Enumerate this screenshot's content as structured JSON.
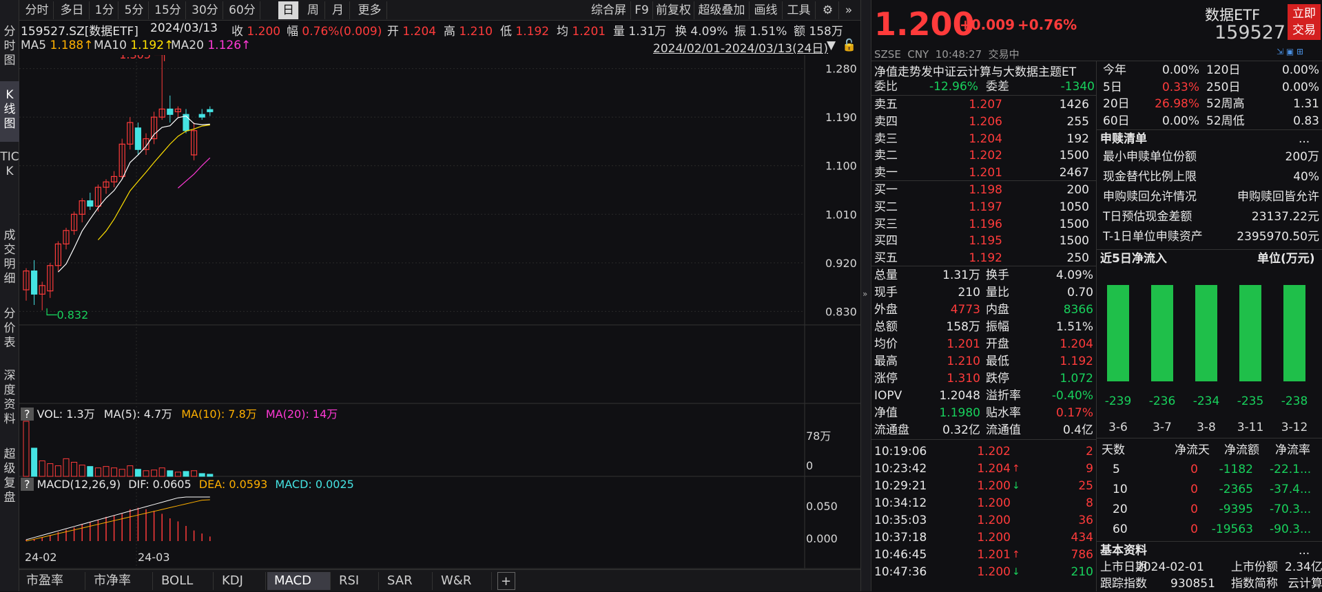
{
  "left_tabs": [
    "分时图",
    "K线图",
    "TICK",
    "成交明细",
    "分价表",
    "深度资料",
    "超级复盘"
  ],
  "toolbar": {
    "periods": [
      "分时",
      "多日",
      "1分",
      "5分",
      "15分",
      "30分",
      "60分",
      "日",
      "周",
      "月",
      "更多"
    ],
    "active": "日",
    "tools": [
      "综合屏",
      "F9",
      "前复权",
      "超级叠加",
      "画线",
      "工具"
    ]
  },
  "info": {
    "code": "159527.SZ[数据ETF]",
    "date": "2024/03/13",
    "close_label": "收",
    "close": "1.200",
    "chg_label": "幅",
    "chg": "0.76%(0.009)",
    "open_label": "开",
    "open": "1.204",
    "high_label": "高",
    "high": "1.210",
    "low_label": "低",
    "low": "1.192",
    "avg_label": "均",
    "avg": "1.201",
    "vol_label": "量",
    "vol": "1.31万",
    "turn_label": "换",
    "turn": "4.09%",
    "amp_label": "振",
    "amp": "1.51%",
    "amt_label": "额",
    "amt": "158万"
  },
  "ma": {
    "ma5_label": "MA5",
    "ma5": "1.188↑",
    "ma10_label": "MA10",
    "ma10": "1.192↑",
    "ma20_label": "MA20",
    "ma20": "1.126↑",
    "range": "2024/02/01-2024/03/13(24日)"
  },
  "price_axis": [
    "1.280",
    "1.190",
    "1.100",
    "1.010",
    "0.920",
    "0.830"
  ],
  "max_label": "1.305",
  "min_label": "0.832",
  "vol_panel": {
    "q": "?",
    "label": "VOL: 1.3万",
    "ma5": "MA(5): 4.7万",
    "ma10": "MA(10): 7.8万",
    "ma20": "MA(20): 14万",
    "axis": [
      "78万",
      "0"
    ]
  },
  "macd_panel": {
    "q": "?",
    "label": "MACD(12,26,9)",
    "dif": "DIF: 0.0605",
    "dea": "DEA: 0.0593",
    "macd": "MACD: 0.0025",
    "axis": [
      "0.050",
      "0.000"
    ]
  },
  "x_axis": [
    "24-02",
    "24-03"
  ],
  "bottom_tabs": [
    "市盈率",
    "市净率",
    "BOLL",
    "KDJ",
    "MACD",
    "RSI",
    "SAR",
    "W&R"
  ],
  "bottom_active": "MACD",
  "chart_data": {
    "type": "candlestick",
    "days": [
      {
        "o": 0.87,
        "h": 0.91,
        "l": 0.85,
        "c": 0.905,
        "up": true
      },
      {
        "o": 0.905,
        "h": 0.925,
        "l": 0.842,
        "c": 0.862,
        "up": false
      },
      {
        "o": 0.862,
        "h": 0.885,
        "l": 0.832,
        "c": 0.878,
        "up": true
      },
      {
        "o": 0.868,
        "h": 0.92,
        "l": 0.855,
        "c": 0.915,
        "up": true
      },
      {
        "o": 0.915,
        "h": 0.96,
        "l": 0.905,
        "c": 0.955,
        "up": true
      },
      {
        "o": 0.955,
        "h": 0.985,
        "l": 0.945,
        "c": 0.98,
        "up": true
      },
      {
        "o": 0.98,
        "h": 1.015,
        "l": 0.972,
        "c": 1.01,
        "up": true
      },
      {
        "o": 1.01,
        "h": 1.04,
        "l": 0.995,
        "c": 1.035,
        "up": true
      },
      {
        "o": 1.035,
        "h": 1.05,
        "l": 1.018,
        "c": 1.025,
        "up": false
      },
      {
        "o": 1.025,
        "h": 1.065,
        "l": 1.015,
        "c": 1.06,
        "up": true
      },
      {
        "o": 1.06,
        "h": 1.075,
        "l": 1.048,
        "c": 1.07,
        "up": true
      },
      {
        "o": 1.07,
        "h": 1.09,
        "l": 1.06,
        "c": 1.08,
        "up": true
      },
      {
        "o": 1.08,
        "h": 1.15,
        "l": 1.075,
        "c": 1.14,
        "up": true
      },
      {
        "o": 1.14,
        "h": 1.19,
        "l": 1.13,
        "c": 1.18,
        "up": true
      },
      {
        "o": 1.17,
        "h": 1.18,
        "l": 1.12,
        "c": 1.13,
        "up": false
      },
      {
        "o": 1.13,
        "h": 1.16,
        "l": 1.12,
        "c": 1.15,
        "up": true
      },
      {
        "o": 1.15,
        "h": 1.2,
        "l": 1.14,
        "c": 1.19,
        "up": true
      },
      {
        "o": 1.19,
        "h": 1.305,
        "l": 1.185,
        "c": 1.205,
        "up": true
      },
      {
        "o": 1.205,
        "h": 1.23,
        "l": 1.18,
        "c": 1.195,
        "up": false
      },
      {
        "o": 1.2,
        "h": 1.21,
        "l": 1.19,
        "c": 1.205,
        "up": true
      },
      {
        "o": 1.195,
        "h": 1.205,
        "l": 1.16,
        "c": 1.165,
        "up": false
      },
      {
        "o": 1.165,
        "h": 1.18,
        "l": 1.11,
        "c": 1.12,
        "up": true
      },
      {
        "o": 1.19,
        "h": 1.205,
        "l": 1.185,
        "c": 1.195,
        "up": false
      },
      {
        "o": 1.204,
        "h": 1.21,
        "l": 1.192,
        "c": 1.2,
        "up": false
      }
    ],
    "ylim": [
      0.805,
      1.305
    ]
  },
  "quote": {
    "price": "1.200",
    "chg": "+0.009",
    "pct": "+0.76%",
    "name": "数据ETF",
    "code": "159527",
    "btn": "立即交易",
    "exchange": "SZSE",
    "currency": "CNY",
    "time": "10:48:27",
    "status": "交易中",
    "fullname": "净值走势发中证云计算与大数据主题ET"
  },
  "orderbook": {
    "wb_label": "委比",
    "wb": "-12.96%",
    "wc_label": "委差",
    "wc": "-1340",
    "asks": [
      {
        "l": "卖五",
        "p": "1.207",
        "v": "1426"
      },
      {
        "l": "卖四",
        "p": "1.206",
        "v": "255"
      },
      {
        "l": "卖三",
        "p": "1.204",
        "v": "192"
      },
      {
        "l": "卖二",
        "p": "1.202",
        "v": "1500"
      },
      {
        "l": "卖一",
        "p": "1.201",
        "v": "2467"
      }
    ],
    "bids": [
      {
        "l": "买一",
        "p": "1.198",
        "v": "200"
      },
      {
        "l": "买二",
        "p": "1.197",
        "v": "1050"
      },
      {
        "l": "买三",
        "p": "1.196",
        "v": "1500"
      },
      {
        "l": "买四",
        "p": "1.195",
        "v": "1500"
      },
      {
        "l": "买五",
        "p": "1.192",
        "v": "250"
      }
    ]
  },
  "stats": [
    {
      "a": "总量",
      "b": "1.31万",
      "c": "换手",
      "d": "4.09%",
      "bc": "white",
      "dc": "white"
    },
    {
      "a": "现手",
      "b": "210",
      "c": "量比",
      "d": "0.70",
      "bc": "white",
      "dc": "white"
    },
    {
      "a": "外盘",
      "b": "4773",
      "c": "内盘",
      "d": "8366",
      "bc": "red",
      "dc": "green"
    },
    {
      "a": "总额",
      "b": "158万",
      "c": "振幅",
      "d": "1.51%",
      "bc": "white",
      "dc": "white"
    },
    {
      "a": "均价",
      "b": "1.201",
      "c": "开盘",
      "d": "1.204",
      "bc": "red",
      "dc": "red"
    },
    {
      "a": "最高",
      "b": "1.210",
      "c": "最低",
      "d": "1.192",
      "bc": "red",
      "dc": "red"
    },
    {
      "a": "涨停",
      "b": "1.310",
      "c": "跌停",
      "d": "1.072",
      "bc": "red",
      "dc": "green"
    },
    {
      "a": "IOPV",
      "b": "1.2048",
      "c": "溢折率",
      "d": "-0.40%",
      "bc": "white",
      "dc": "green"
    },
    {
      "a": "净值",
      "b": "1.1980",
      "c": "贴水率",
      "d": "0.17%",
      "bc": "green",
      "dc": "red"
    },
    {
      "a": "流通盘",
      "b": "0.32亿",
      "c": "流通值",
      "d": "0.4亿",
      "bc": "white",
      "dc": "white"
    }
  ],
  "ticks": [
    {
      "t": "10:19:06",
      "p": "1.202",
      "a": "",
      "v": "2",
      "vc": "red"
    },
    {
      "t": "10:23:42",
      "p": "1.204",
      "a": "↑",
      "v": "9",
      "vc": "red"
    },
    {
      "t": "10:29:21",
      "p": "1.200",
      "a": "↓",
      "v": "25",
      "vc": "red"
    },
    {
      "t": "10:34:12",
      "p": "1.200",
      "a": "",
      "v": "8",
      "vc": "red"
    },
    {
      "t": "10:35:03",
      "p": "1.200",
      "a": "",
      "v": "36",
      "vc": "red"
    },
    {
      "t": "10:37:18",
      "p": "1.200",
      "a": "",
      "v": "434",
      "vc": "red"
    },
    {
      "t": "10:46:45",
      "p": "1.201",
      "a": "↑",
      "v": "786",
      "vc": "red"
    },
    {
      "t": "10:47:36",
      "p": "1.200",
      "a": "↓",
      "v": "210",
      "vc": "green"
    }
  ],
  "perf": [
    {
      "a": "今年",
      "b": "0.00%",
      "c": "120日",
      "d": "0.00%",
      "bc": "white"
    },
    {
      "a": "5日",
      "b": "0.33%",
      "c": "250日",
      "d": "0.00%",
      "bc": "red"
    },
    {
      "a": "20日",
      "b": "26.98%",
      "c": "52周高",
      "d": "1.31",
      "bc": "red"
    },
    {
      "a": "60日",
      "b": "0.00%",
      "c": "52周低",
      "d": "0.83",
      "bc": "white"
    }
  ],
  "subscription": {
    "title": "申赎清单",
    "more": "...",
    "rows": [
      {
        "k": "最小申赎单位份额",
        "v": "200万"
      },
      {
        "k": "现金替代比例上限",
        "v": "40%"
      },
      {
        "k": "申购赎回允许情况",
        "v": "申购赎回皆允许"
      },
      {
        "k": "T日预估现金差额",
        "v": "23137.22元"
      },
      {
        "k": "T-1日单位申赎资产",
        "v": "2395970.50元"
      }
    ]
  },
  "flow": {
    "title": "近5日净流入",
    "unit": "单位(万元)",
    "bars": [
      {
        "d": "3-6",
        "v": -239
      },
      {
        "d": "3-7",
        "v": -236
      },
      {
        "d": "3-8",
        "v": -234
      },
      {
        "d": "3-11",
        "v": -235
      },
      {
        "d": "3-12",
        "v": -238
      }
    ],
    "headers": [
      "天数",
      "净流天",
      "净流额",
      "净流率"
    ],
    "rows": [
      {
        "a": "5",
        "b": "0",
        "c": "-1182",
        "d": "-22.1..."
      },
      {
        "a": "10",
        "b": "0",
        "c": "-2365",
        "d": "-37.4..."
      },
      {
        "a": "20",
        "b": "0",
        "c": "-9395",
        "d": "-70.3..."
      },
      {
        "a": "60",
        "b": "0",
        "c": "-19563",
        "d": "-90.3..."
      }
    ]
  },
  "basic": {
    "title": "基本资料",
    "more": "...",
    "l1": "上市日期",
    "v1": "2024-02-01",
    "l2": "上市份额",
    "v2": "2.34亿",
    "l3": "跟踪指数",
    "v3": "930851",
    "l4": "指数简称",
    "v4": "云计算"
  }
}
